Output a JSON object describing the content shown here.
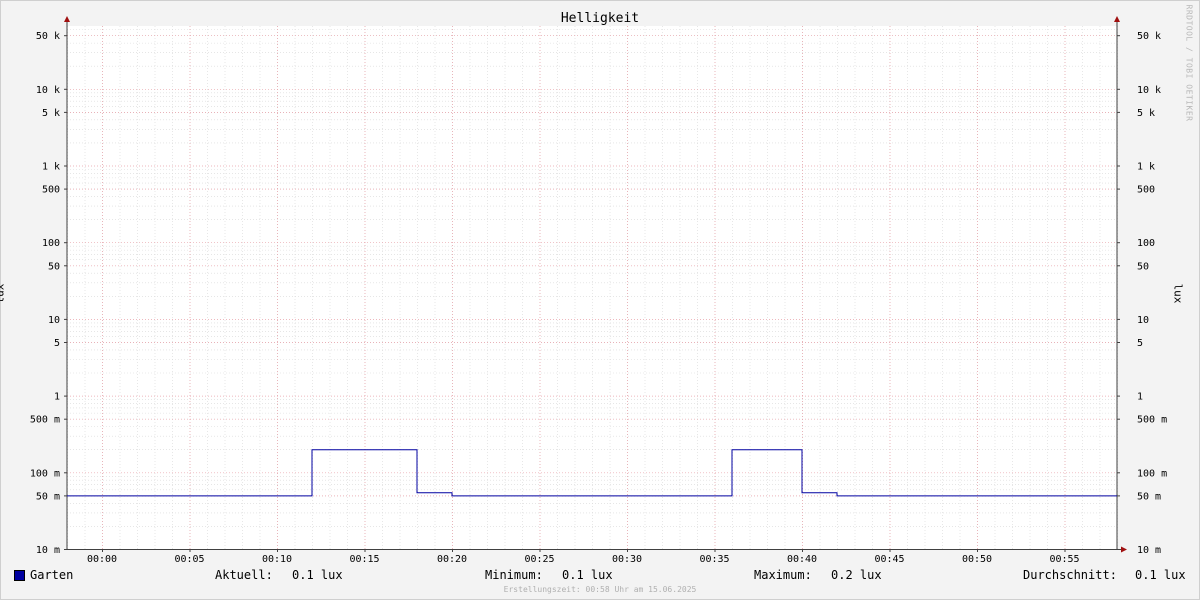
{
  "chart_data": {
    "type": "line",
    "title": "Helligkeit",
    "ylabel": "lux",
    "yscale": "log",
    "ylim": [
      0.01,
      80000
    ],
    "x_ticks": [
      "00:00",
      "00:05",
      "00:10",
      "00:15",
      "00:20",
      "00:25",
      "00:30",
      "00:35",
      "00:40",
      "00:45",
      "00:50",
      "00:55"
    ],
    "y_ticks": [
      {
        "value": 0.01,
        "label": "10 m"
      },
      {
        "value": 0.05,
        "label": "50 m"
      },
      {
        "value": 0.1,
        "label": "100 m"
      },
      {
        "value": 0.5,
        "label": "500 m"
      },
      {
        "value": 1,
        "label": "1"
      },
      {
        "value": 5,
        "label": "5"
      },
      {
        "value": 10,
        "label": "10"
      },
      {
        "value": 50,
        "label": "50"
      },
      {
        "value": 100,
        "label": "100"
      },
      {
        "value": 500,
        "label": "500"
      },
      {
        "value": 1000,
        "label": "1 k"
      },
      {
        "value": 5000,
        "label": "5 k"
      },
      {
        "value": 10000,
        "label": "10 k"
      },
      {
        "value": 50000,
        "label": "50 k"
      }
    ],
    "grid": true,
    "series": [
      {
        "name": "Garten",
        "color": "#0000a0",
        "x": [
          "23:58",
          "00:12",
          "00:12",
          "00:18",
          "00:18",
          "00:20",
          "00:20",
          "00:36",
          "00:36",
          "00:40",
          "00:40",
          "00:42",
          "00:42",
          "00:58"
        ],
        "values": [
          0.05,
          0.05,
          0.2,
          0.2,
          0.055,
          0.055,
          0.05,
          0.05,
          0.2,
          0.2,
          0.055,
          0.055,
          0.05,
          0.05
        ]
      }
    ]
  },
  "legend": {
    "series_name": "Garten",
    "current_label": "Aktuell:",
    "current_value": "0.1 lux",
    "min_label": "Minimum:",
    "min_value": "0.1 lux",
    "max_label": "Maximum:",
    "max_value": "0.2 lux",
    "avg_label": "Durchschnitt:",
    "avg_value": "0.1 lux"
  },
  "watermark": "RRDTOOL / TOBI OETIKER",
  "footer": "Erstellungszeit: 00:58 Uhr am 15.06.2025"
}
